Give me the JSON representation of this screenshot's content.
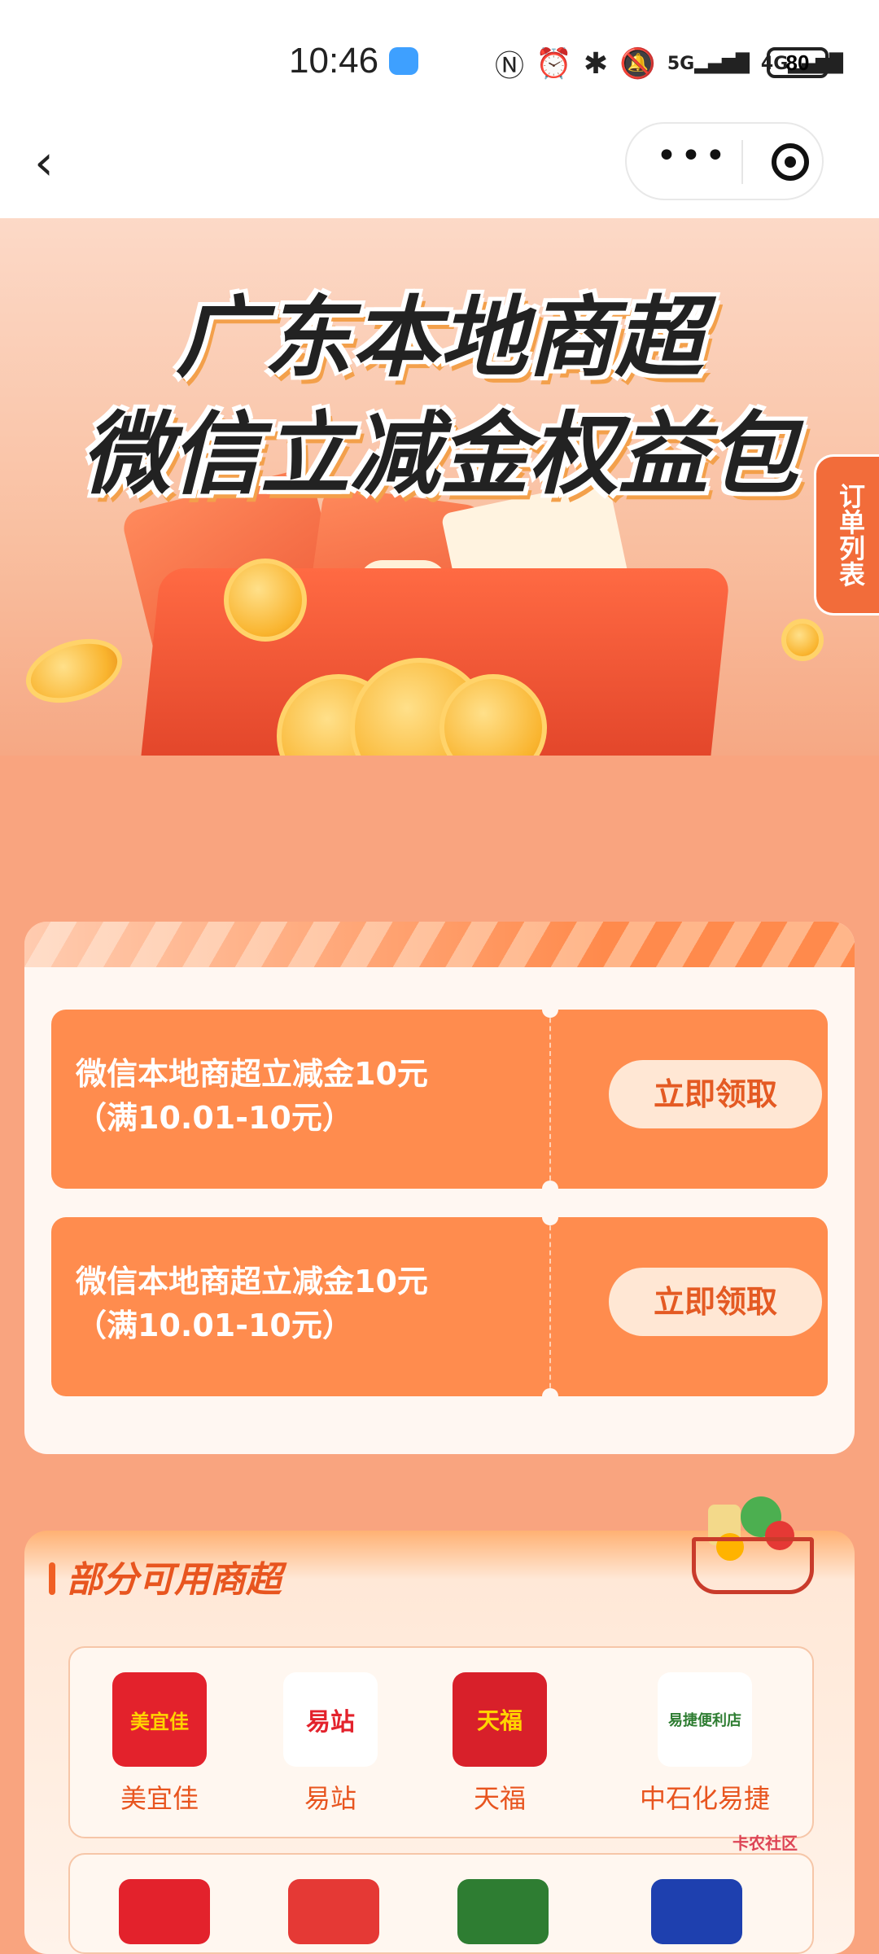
{
  "status_bar": {
    "time": "10:46",
    "icons": [
      "nfc-icon",
      "alarm-icon",
      "bluetooth-icon",
      "mute-icon",
      "5g-signal-icon",
      "4g-signal-icon"
    ],
    "sig_5g": "5G",
    "sig_4g": "4G",
    "battery": "80"
  },
  "nav": {
    "back_icon": "‹",
    "more_icon": "•••"
  },
  "banner": {
    "title_line1": "广东本地商超",
    "title_line2": "微信立减金权益包"
  },
  "order_tab": "订单列表",
  "coupons": [
    {
      "line1": "微信本地商超立减金10元",
      "line2": "（满10.01-10元）",
      "button": "立即领取"
    },
    {
      "line1": "微信本地商超立减金10元",
      "line2": "（满10.01-10元）",
      "button": "立即领取"
    }
  ],
  "stores_section": {
    "title": "部分可用商超",
    "stores": [
      {
        "name": "美宜佳",
        "logo_text": "美宜佳",
        "logo_color": "#e3222c"
      },
      {
        "name": "易站",
        "logo_text": "易站",
        "logo_color": "#ffffff"
      },
      {
        "name": "天福",
        "logo_text": "天福",
        "logo_color": "#d8202a"
      },
      {
        "name": "中石化易捷",
        "logo_text": "易捷便利店",
        "logo_color": "#ffffff"
      }
    ]
  },
  "watermark": "卡农社区",
  "colors": {
    "background": "#f9a47f",
    "coupon": "#ff8c4e",
    "accent": "#e8551f"
  }
}
